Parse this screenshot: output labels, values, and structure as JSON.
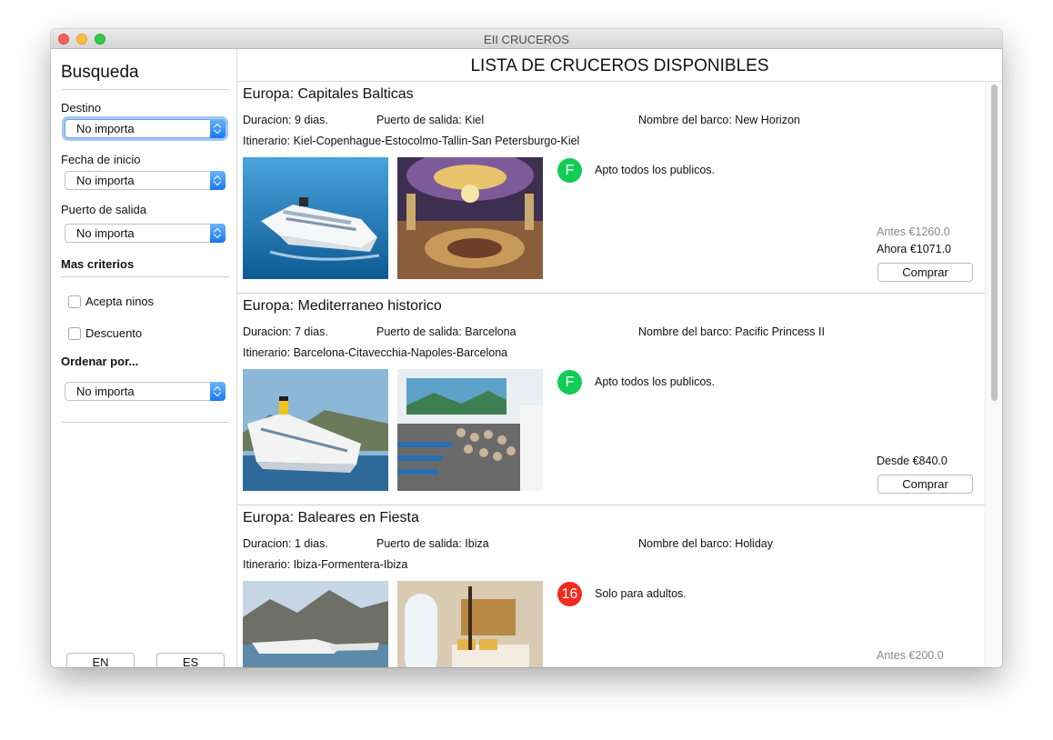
{
  "window": {
    "title": "EII CRUCEROS"
  },
  "sidebar": {
    "title": "Busqueda",
    "destino": {
      "label": "Destino",
      "value": "No importa"
    },
    "fecha": {
      "label": "Fecha de inicio",
      "value": "No importa"
    },
    "puerto": {
      "label": "Puerto de salida",
      "value": "No importa"
    },
    "mas_criterios": "Mas criterios",
    "acepta_ninos": "Acepta ninos",
    "descuento": "Descuento",
    "ordenar": {
      "label": "Ordenar por...",
      "value": "No importa"
    },
    "lang_en": "EN",
    "lang_es": "ES"
  },
  "main": {
    "header": "LISTA DE CRUCEROS DISPONIBLES"
  },
  "colors": {
    "badge_green": "#12cc55",
    "badge_red": "#f22b1e",
    "select_accent": "#1778f2"
  },
  "cruises": [
    {
      "title": "Europa: Capitales Balticas",
      "duracion": "Duracion: 9 dias.",
      "puerto": "Puerto de salida: Kiel",
      "barco": "Nombre del barco: New Horizon",
      "itinerario": "Itinerario: Kiel-Copenhague-Estocolmo-Tallin-San Petersburgo-Kiel",
      "rating": "F",
      "audience": "Apto todos los publicos.",
      "price_old": "Antes €1260.0",
      "price": "Ahora €1071.0",
      "buy": "Comprar"
    },
    {
      "title": "Europa: Mediterraneo historico",
      "duracion": "Duracion: 7 dias.",
      "puerto": "Puerto de salida: Barcelona",
      "barco": "Nombre del barco: Pacific Princess II",
      "itinerario": "Itinerario: Barcelona-Citavecchia-Napoles-Barcelona",
      "rating": "F",
      "audience": "Apto todos los publicos.",
      "price": "Desde €840.0",
      "buy": "Comprar"
    },
    {
      "title": "Europa: Baleares en Fiesta",
      "duracion": "Duracion: 1 dias.",
      "puerto": "Puerto de salida: Ibiza",
      "barco": "Nombre del barco: Holiday",
      "itinerario": "Itinerario: Ibiza-Formentera-Ibiza",
      "rating": "16",
      "audience": "Solo para adultos.",
      "price_old": "Antes €200.0"
    }
  ]
}
